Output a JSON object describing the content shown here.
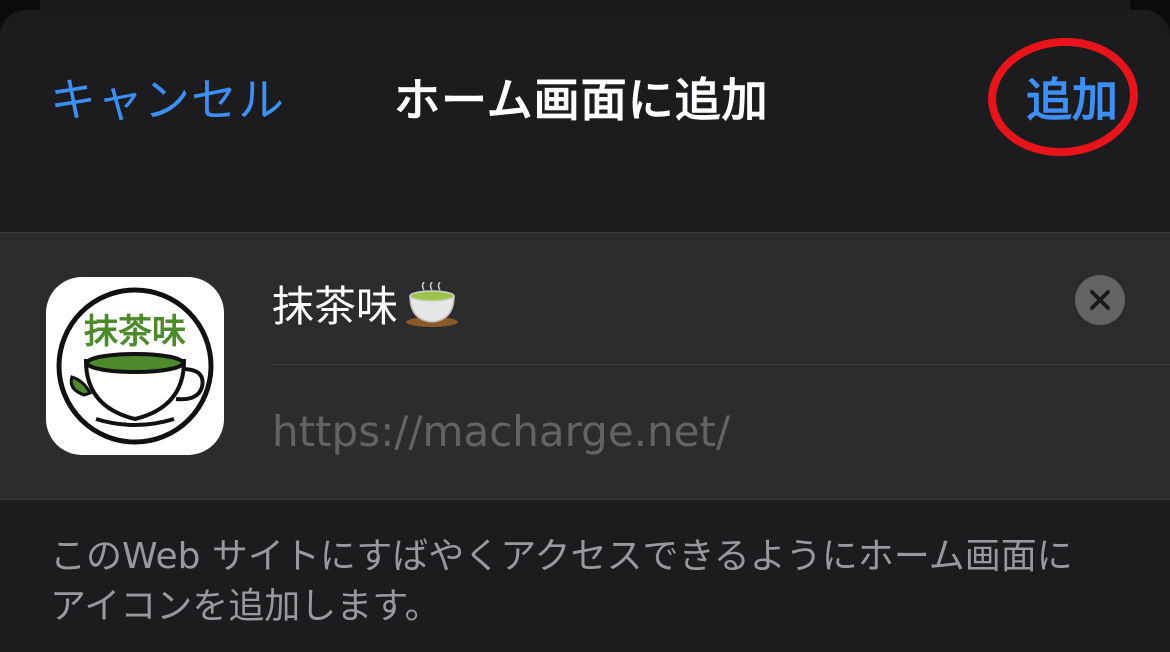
{
  "nav": {
    "cancel_label": "キャンセル",
    "title": "ホーム画面に追加",
    "add_label": "追加"
  },
  "site": {
    "name": "抹茶味",
    "url": "https://macharge.net/",
    "icon_text": "抹茶味",
    "name_emoji": "teacup-emoji"
  },
  "description": {
    "line1": "このWeb サイトにすばやくアクセスできるようにホーム画面に",
    "line2": "アイコンを追加します。"
  },
  "colors": {
    "accent": "#3d8ff5",
    "highlight_ring": "#e8141b",
    "sheet_bg": "#1c1c1e",
    "card_bg": "#2c2c2e",
    "icon_green": "#4d8a2c"
  }
}
